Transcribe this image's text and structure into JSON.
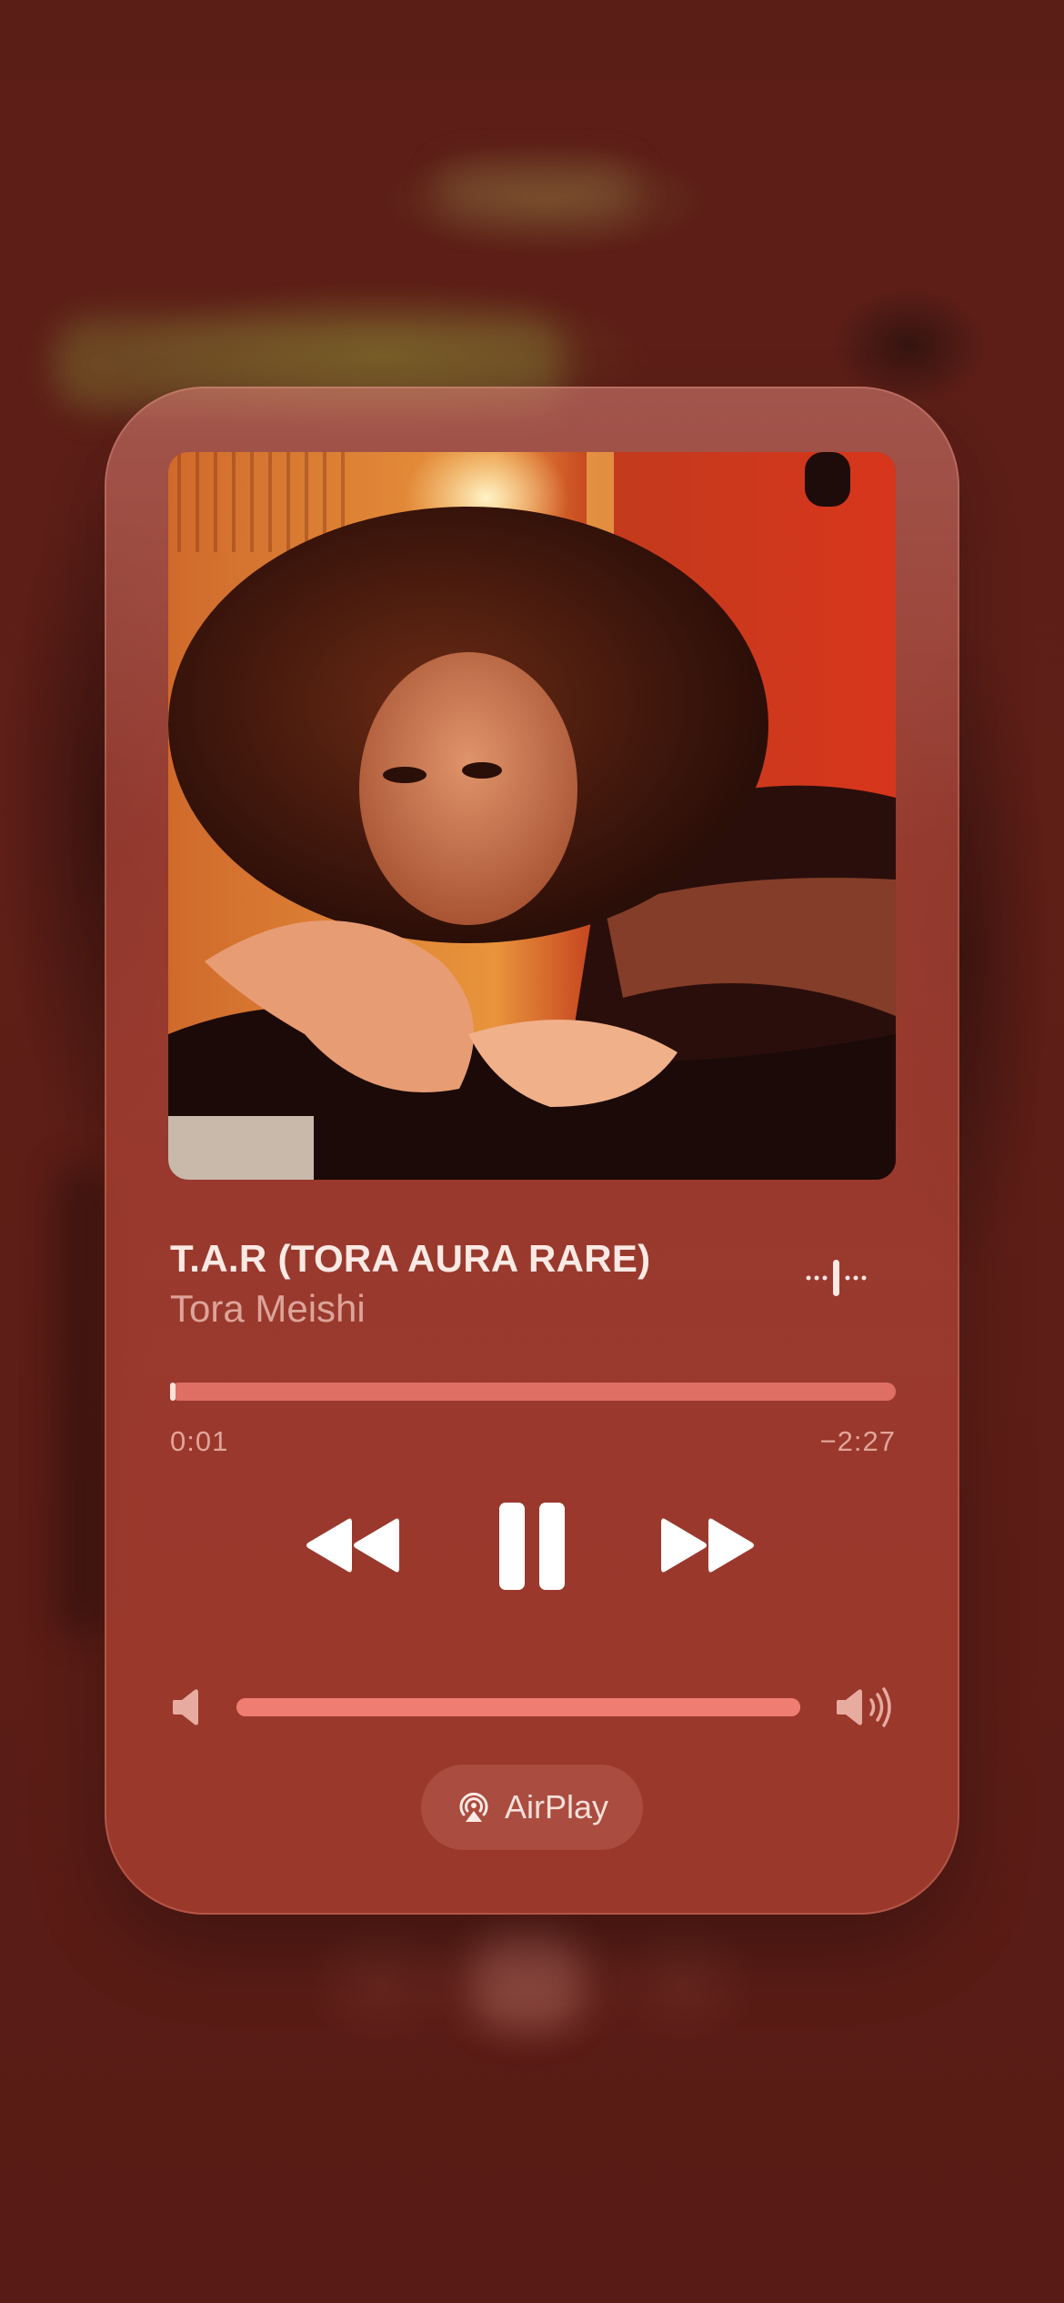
{
  "now_playing": {
    "title": "T.A.R (TORA AURA RARE)",
    "artist": "Tora Meishi",
    "elapsed": "0:01",
    "remaining": "−2:27",
    "progress_fraction": 0.007,
    "volume_fraction": 1.0
  },
  "controls": {
    "rewind_icon": "backward-icon",
    "pause_icon": "pause-icon",
    "forward_icon": "forward-icon",
    "lyrics_icon": "waveform-icon"
  },
  "airplay": {
    "label": "AirPlay",
    "icon": "airplay-icon"
  },
  "colors": {
    "background": "#5a1c16",
    "card": "#a83c30",
    "track": "#eb786e",
    "text_primary": "#fbe9e4"
  }
}
